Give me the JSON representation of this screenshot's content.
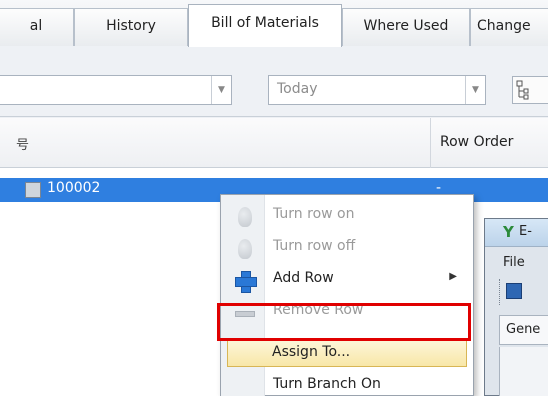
{
  "tabs": [
    {
      "label": "al",
      "active": false
    },
    {
      "label": "History",
      "active": false
    },
    {
      "label": "Bill of Materials",
      "active": true
    },
    {
      "label": "Where Used",
      "active": false
    },
    {
      "label": "Change",
      "active": false
    }
  ],
  "filters": {
    "combo1_value": "",
    "date_value": "Today",
    "tree_icon": "tree-structure-icon"
  },
  "grid": {
    "column_a_header": "号",
    "column_b_header": "Row Order",
    "selected_row_number": "100002",
    "selected_row_order": "-"
  },
  "dialog": {
    "title": "E-",
    "menu_file": "File",
    "tab_label": "Gene"
  },
  "context_menu": {
    "items": [
      {
        "label": "Turn row on",
        "enabled": false,
        "icon": "lightbulb-icon"
      },
      {
        "label": "Turn row off",
        "enabled": false,
        "icon": "lightbulb-icon"
      },
      {
        "label": "Add Row",
        "enabled": true,
        "icon": "plus-icon",
        "submenu": true
      },
      {
        "label": "Remove Row",
        "enabled": false,
        "icon": "minus-icon"
      },
      {
        "label": "Assign To...",
        "enabled": true,
        "highlighted": true
      },
      {
        "label": "Turn Branch On",
        "enabled": true
      }
    ]
  },
  "colors": {
    "selection": "#2f7fe0",
    "highlight_border": "#e00000",
    "hover_fill": "#f8e7a8"
  }
}
